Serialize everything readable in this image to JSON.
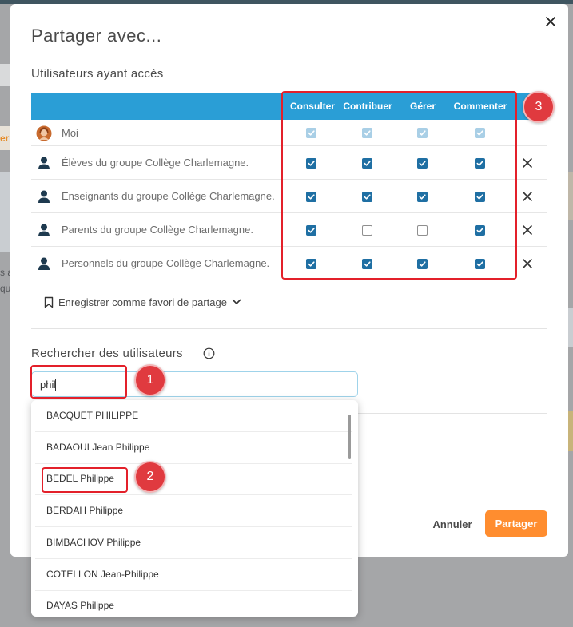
{
  "modal": {
    "title": "Partager avec...",
    "close_label": "close"
  },
  "access": {
    "section_title": "Utilisateurs ayant accès",
    "columns": [
      "Consulter",
      "Contribuer",
      "Gérer",
      "Commenter"
    ],
    "rows": [
      {
        "label": "Moi",
        "icon": "user-avatar-icon",
        "perms": [
          true,
          true,
          true,
          true
        ],
        "disabled": true,
        "removable": false
      },
      {
        "label": "Élèves du groupe Collège Charlemagne.",
        "icon": "group-icon",
        "perms": [
          true,
          true,
          true,
          true
        ],
        "disabled": false,
        "removable": true
      },
      {
        "label": "Enseignants du groupe Collège Charlemagne.",
        "icon": "group-icon",
        "perms": [
          true,
          true,
          true,
          true
        ],
        "disabled": false,
        "removable": true
      },
      {
        "label": "Parents du groupe Collège Charlemagne.",
        "icon": "group-icon",
        "perms": [
          true,
          false,
          false,
          true
        ],
        "disabled": false,
        "removable": true
      },
      {
        "label": "Personnels du groupe Collège Charlemagne.",
        "icon": "group-icon",
        "perms": [
          true,
          true,
          true,
          true
        ],
        "disabled": false,
        "removable": true
      }
    ]
  },
  "favorite": {
    "label": "Enregistrer comme favori de partage"
  },
  "search": {
    "title": "Rechercher des utilisateurs",
    "value": "phil",
    "results": [
      "BACQUET PHILIPPE",
      "BADAOUI Jean Philippe",
      "BEDEL Philippe",
      "BERDAH Philippe",
      "BIMBACHOV Philippe",
      "COTELLON Jean-Philippe",
      "DAYAS Philippe"
    ]
  },
  "footer": {
    "cancel_label": "Annuler",
    "share_label": "Partager"
  },
  "background": {
    "fragment_orange": "er",
    "fragment_a": "s a",
    "fragment_b": "qu"
  },
  "annotations": [
    "1",
    "2",
    "3"
  ],
  "colors": {
    "header_blue": "#2a9ed6",
    "checkbox_blue": "#1f6fa3",
    "share_orange": "#ff8d2f",
    "annotation_red": "#e3202a"
  }
}
